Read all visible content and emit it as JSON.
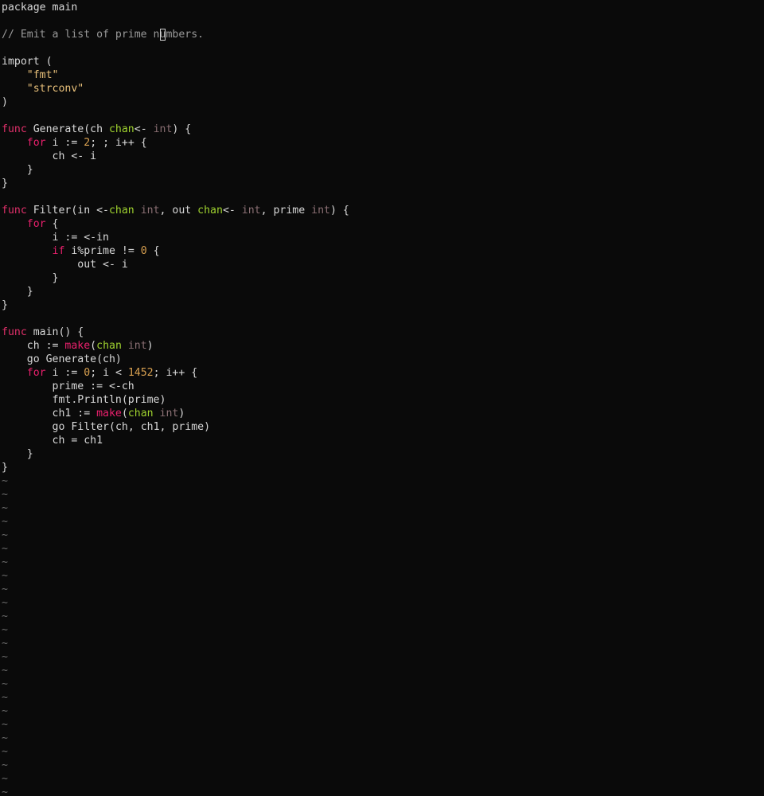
{
  "editor": {
    "colors": {
      "background": "#0a0a0a",
      "text": "#d8d8d8",
      "keyword": "#e0306a",
      "control": "#e8206c",
      "string": "#e8c07a",
      "number": "#d8a050",
      "type": "#8a6f73",
      "chan": "#9fd22f",
      "comment": "#9a9a9a",
      "tilde": "#6a6a6a"
    },
    "cursor": {
      "line": 2,
      "column": 25
    },
    "lines": [
      [
        [
          "package",
          "package"
        ],
        [
          "text",
          " main"
        ]
      ],
      [],
      [
        [
          "comment",
          "// Emit a list of prime numbers."
        ]
      ],
      [],
      [
        [
          "package",
          "import"
        ],
        [
          "text",
          " ("
        ]
      ],
      [
        [
          "text",
          "    "
        ],
        [
          "string",
          "\"fmt\""
        ]
      ],
      [
        [
          "text",
          "    "
        ],
        [
          "string",
          "\"strconv\""
        ]
      ],
      [
        [
          "text",
          ")"
        ]
      ],
      [],
      [
        [
          "keyword",
          "func"
        ],
        [
          "text",
          " Generate(ch "
        ],
        [
          "chan",
          "chan"
        ],
        [
          "text",
          "<- "
        ],
        [
          "type",
          "int"
        ],
        [
          "text",
          ") {"
        ]
      ],
      [
        [
          "text",
          "    "
        ],
        [
          "control",
          "for"
        ],
        [
          "text",
          " i := "
        ],
        [
          "number",
          "2"
        ],
        [
          "text",
          "; ; i++ {"
        ]
      ],
      [
        [
          "text",
          "        ch <- i"
        ]
      ],
      [
        [
          "text",
          "    }"
        ]
      ],
      [
        [
          "text",
          "}"
        ]
      ],
      [],
      [
        [
          "keyword",
          "func"
        ],
        [
          "text",
          " Filter(in <-"
        ],
        [
          "chan",
          "chan"
        ],
        [
          "text",
          " "
        ],
        [
          "type",
          "int"
        ],
        [
          "text",
          ", out "
        ],
        [
          "chan",
          "chan"
        ],
        [
          "text",
          "<- "
        ],
        [
          "type",
          "int"
        ],
        [
          "text",
          ", prime "
        ],
        [
          "type",
          "int"
        ],
        [
          "text",
          ") {"
        ]
      ],
      [
        [
          "text",
          "    "
        ],
        [
          "control",
          "for"
        ],
        [
          "text",
          " {"
        ]
      ],
      [
        [
          "text",
          "        i := <-in"
        ]
      ],
      [
        [
          "text",
          "        "
        ],
        [
          "control",
          "if"
        ],
        [
          "text",
          " i%prime != "
        ],
        [
          "number",
          "0"
        ],
        [
          "text",
          " {"
        ]
      ],
      [
        [
          "text",
          "            out <- i"
        ]
      ],
      [
        [
          "text",
          "        }"
        ]
      ],
      [
        [
          "text",
          "    }"
        ]
      ],
      [
        [
          "text",
          "}"
        ]
      ],
      [],
      [
        [
          "keyword",
          "func"
        ],
        [
          "text",
          " main() {"
        ]
      ],
      [
        [
          "text",
          "    ch := "
        ],
        [
          "control",
          "make"
        ],
        [
          "text",
          "("
        ],
        [
          "chan",
          "chan"
        ],
        [
          "text",
          " "
        ],
        [
          "type",
          "int"
        ],
        [
          "text",
          ")"
        ]
      ],
      [
        [
          "text",
          "    "
        ],
        [
          "package",
          "go"
        ],
        [
          "text",
          " Generate(ch)"
        ]
      ],
      [
        [
          "text",
          "    "
        ],
        [
          "control",
          "for"
        ],
        [
          "text",
          " i := "
        ],
        [
          "number",
          "0"
        ],
        [
          "text",
          "; i < "
        ],
        [
          "number",
          "1452"
        ],
        [
          "text",
          "; i++ {"
        ]
      ],
      [
        [
          "text",
          "        prime := <-ch"
        ]
      ],
      [
        [
          "text",
          "        fmt.Println(prime)"
        ]
      ],
      [
        [
          "text",
          "        ch1 := "
        ],
        [
          "control",
          "make"
        ],
        [
          "text",
          "("
        ],
        [
          "chan",
          "chan"
        ],
        [
          "text",
          " "
        ],
        [
          "type",
          "int"
        ],
        [
          "text",
          ")"
        ]
      ],
      [
        [
          "text",
          "        "
        ],
        [
          "package",
          "go"
        ],
        [
          "text",
          " Filter(ch, ch1, prime)"
        ]
      ],
      [
        [
          "text",
          "        ch = ch1"
        ]
      ],
      [
        [
          "text",
          "    }"
        ]
      ],
      [
        [
          "text",
          "}"
        ]
      ]
    ],
    "empty_line_marker": "~",
    "empty_line_count": 24
  }
}
